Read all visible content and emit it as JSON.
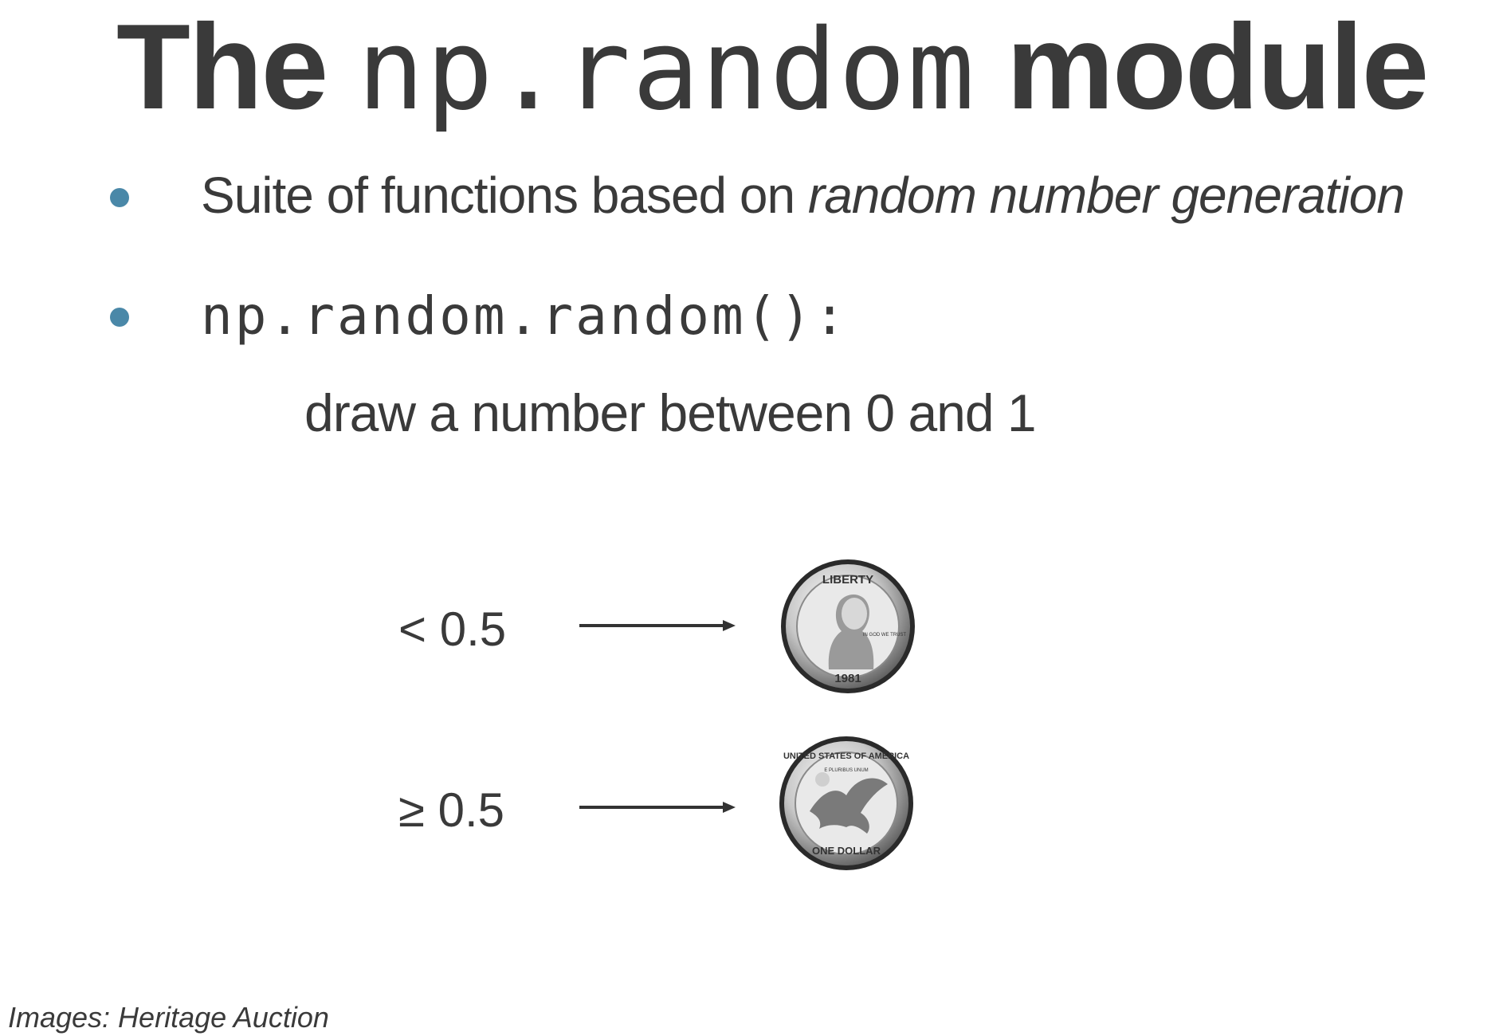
{
  "slide": {
    "title_prefix": "The",
    "title_code": "np.random",
    "title_suffix": "module",
    "bullet_color": "#4a88a8",
    "text_color": "#3a3a3a"
  },
  "bullets": [
    {
      "text": "Suite of functions based on ",
      "emphasis": "random number generation",
      "icon": "bullet-dot-icon"
    },
    {
      "code": "np.random.random():",
      "subtext": "draw a number between 0 and 1",
      "icon": "bullet-dot-icon"
    }
  ],
  "mapping": [
    {
      "condition": "< 0.5",
      "arrow_icon": "arrow-right-icon",
      "outcome_icon": "coin-heads-icon",
      "coin_text_top": "LIBERTY",
      "coin_text_right": "IN GOD WE TRUST",
      "coin_text_bottom": "1981"
    },
    {
      "condition": "≥ 0.5",
      "arrow_icon": "arrow-right-icon",
      "outcome_icon": "coin-tails-icon",
      "coin_text_top": "UNITED STATES OF AMERICA",
      "coin_text_small": "E PLURIBUS UNUM",
      "coin_text_bottom": "ONE DOLLAR"
    }
  ],
  "footer": {
    "credit": "Images: Heritage Auction"
  }
}
